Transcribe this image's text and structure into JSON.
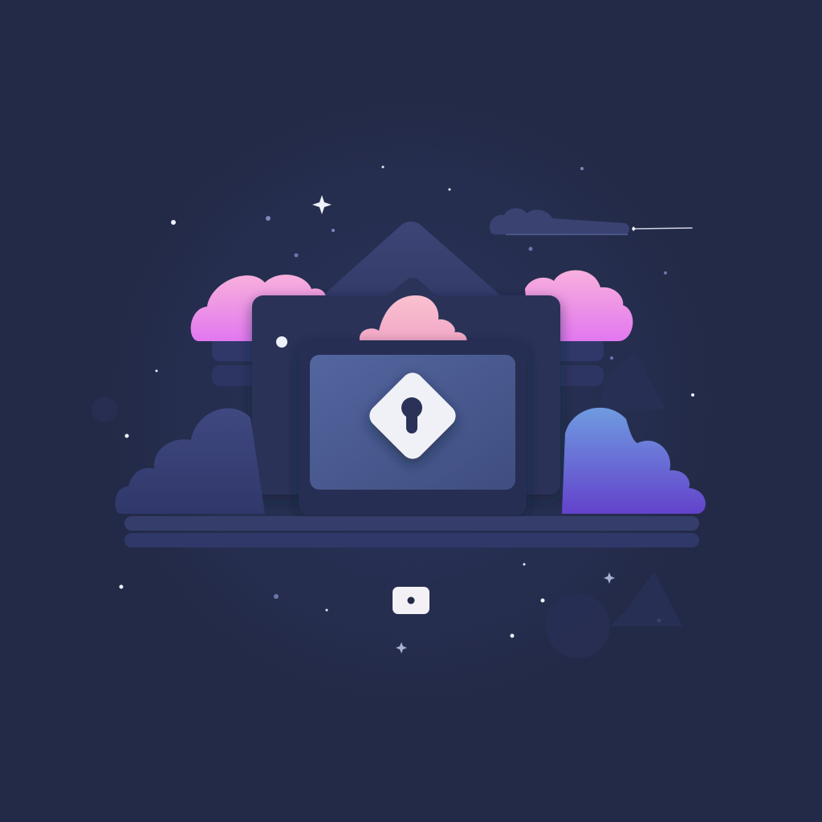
{
  "colors": {
    "background": "#232a47",
    "vignette": "#272f52",
    "card_back": "#2b3358",
    "card_mid": "#262d50",
    "card_front": "#4a5a8e",
    "mountain": "#3a4272",
    "cloud_pink_light": "#f7a5dc",
    "cloud_pink_dark": "#e377f0",
    "cloud_peach": "#f7b8cf",
    "cloud_blue_top": "#6f93dc",
    "cloud_purple_bottom": "#6247cc",
    "cloud_dark": "#3c457a",
    "ground": "#343c69",
    "lock_badge": "#f0f1f6",
    "keyhole": "#2b3358",
    "star": "#eef0fa"
  },
  "icons": {
    "center_lock": "keyhole-lock-icon",
    "bottom_button": "camera-dot-icon",
    "small_dot": "indicator-dot-icon",
    "sparkles": "sparkle-icon"
  }
}
